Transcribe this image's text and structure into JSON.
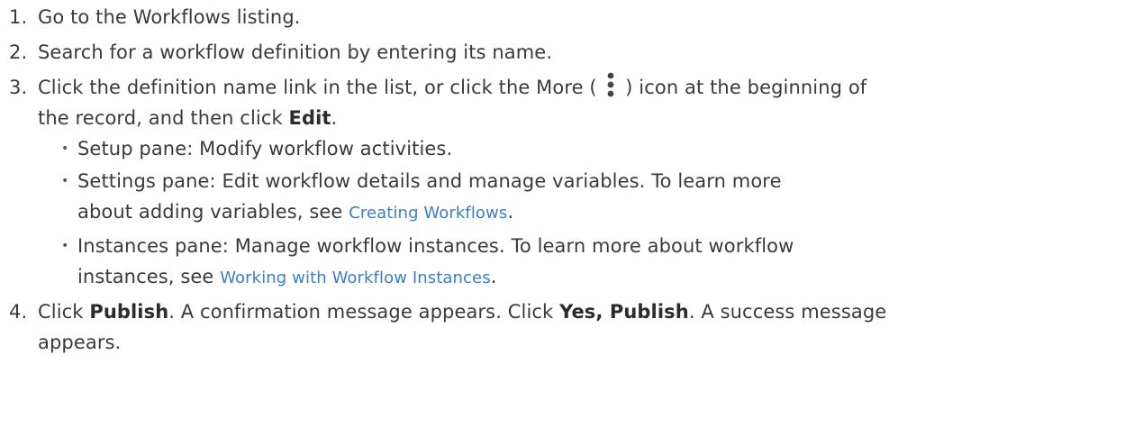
{
  "steps": [
    {
      "num": "1.",
      "text": "Go to the Workflows listing."
    },
    {
      "num": "2.",
      "text": "Search for a workflow definition by entering its name."
    },
    {
      "num": "3.",
      "pre_icon": "Click the definition name link in the list, or click the More ( ",
      "icon": "more-vertical-icon",
      "post_icon": " ) icon at the beginning of",
      "line2_pre": "the record, and then click ",
      "line2_bold": "Edit",
      "line2_post": ".",
      "sub_items": [
        {
          "bullet": "•",
          "text": "Setup pane: Modify workflow activities."
        },
        {
          "bullet": "•",
          "line1": "Settings pane: Edit workflow details and manage variables. To learn more",
          "line2_pre": "about adding variables, see ",
          "link": "Creating Workflows",
          "line2_post": "."
        },
        {
          "bullet": "•",
          "line1": "Instances pane: Manage workflow instances. To learn more about workflow",
          "line2_pre": "instances, see ",
          "link": "Working with Workflow Instances",
          "line2_post": "."
        }
      ]
    },
    {
      "num": "4.",
      "pre": "Click ",
      "bold1": "Publish",
      "mid": ". A confirmation message appears. Click ",
      "bold2": "Yes, Publish",
      "post": ". A success message",
      "line2": "appears."
    }
  ],
  "colors": {
    "text": "#3a3a3a",
    "link": "#3b7ec8"
  }
}
